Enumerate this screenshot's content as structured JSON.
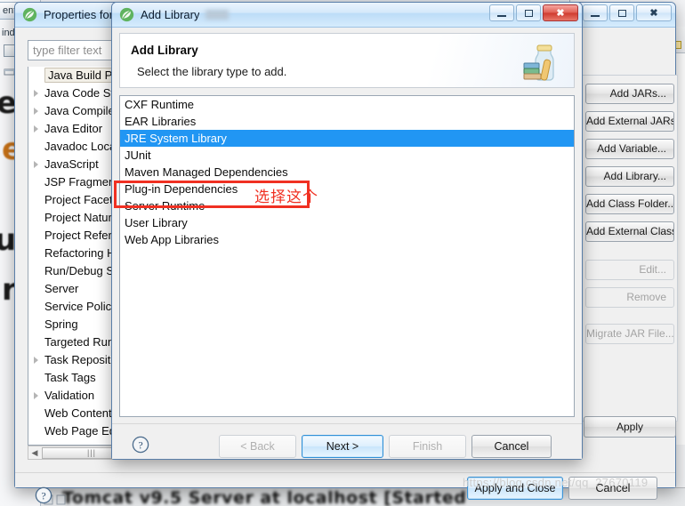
{
  "background": {
    "left_tab_label": "ent",
    "left_tab_label2": "ind",
    "big_letters": [
      "e",
      "e",
      "u",
      "r"
    ],
    "console_text": "Tomcat v9.5 Server at localhost  [Started",
    "nav_back_icon": "arrow-left-icon",
    "nav_forward_icon": "arrow-right-icon"
  },
  "watermark": "https://blog.csdn.net/qq_27670119",
  "properties_dialog": {
    "title": "Properties for",
    "app_icon": "eclipse-leaf-icon",
    "window_controls": {
      "minimize": "minimize-icon",
      "maximize": "maximize-icon",
      "close": "close-icon"
    },
    "filter": {
      "placeholder": "type filter text",
      "value": ""
    },
    "tree_items": [
      {
        "label": "Java Build Path",
        "expandable": false,
        "selected": true
      },
      {
        "label": "Java Code Style",
        "expandable": true,
        "selected": false
      },
      {
        "label": "Java Compiler",
        "expandable": true,
        "selected": false
      },
      {
        "label": "Java Editor",
        "expandable": true,
        "selected": false
      },
      {
        "label": "Javadoc Location",
        "expandable": false,
        "selected": false
      },
      {
        "label": "JavaScript",
        "expandable": true,
        "selected": false
      },
      {
        "label": "JSP Fragment",
        "expandable": false,
        "selected": false
      },
      {
        "label": "Project Facets",
        "expandable": false,
        "selected": false
      },
      {
        "label": "Project Natures",
        "expandable": false,
        "selected": false
      },
      {
        "label": "Project References",
        "expandable": false,
        "selected": false
      },
      {
        "label": "Refactoring History",
        "expandable": false,
        "selected": false
      },
      {
        "label": "Run/Debug Settings",
        "expandable": false,
        "selected": false
      },
      {
        "label": "Server",
        "expandable": false,
        "selected": false
      },
      {
        "label": "Service Policies",
        "expandable": false,
        "selected": false
      },
      {
        "label": "Spring",
        "expandable": false,
        "selected": false
      },
      {
        "label": "Targeted Runtimes",
        "expandable": false,
        "selected": false
      },
      {
        "label": "Task Repository",
        "expandable": true,
        "selected": false
      },
      {
        "label": "Task Tags",
        "expandable": false,
        "selected": false
      },
      {
        "label": "Validation",
        "expandable": true,
        "selected": false
      },
      {
        "label": "Web Content Settings",
        "expandable": false,
        "selected": false
      },
      {
        "label": "Web Page Editor",
        "expandable": false,
        "selected": false
      }
    ],
    "build_path_buttons": [
      {
        "label": "Add JARs...",
        "enabled": true
      },
      {
        "label": "Add External JARs...",
        "enabled": true
      },
      {
        "label": "Add Variable...",
        "enabled": true
      },
      {
        "label": "Add Library...",
        "enabled": true
      },
      {
        "label": "Add Class Folder...",
        "enabled": true
      },
      {
        "label": "Add External Class Folder...",
        "enabled": true
      },
      {
        "label": "Edit...",
        "enabled": false
      },
      {
        "label": "Remove",
        "enabled": false
      },
      {
        "label": "Migrate JAR File...",
        "enabled": false
      }
    ],
    "apply_label": "Apply",
    "apply_and_close_label": "Apply and Close",
    "cancel_label": "Cancel",
    "help_icon": "help-question-icon"
  },
  "add_library_dialog": {
    "title": "Add Library",
    "app_icon": "eclipse-leaf-icon",
    "window_controls": {
      "minimize": "minimize-icon",
      "maximize": "maximize-icon",
      "close": "close-icon"
    },
    "header": {
      "heading": "Add Library",
      "description": "Select the library type to add.",
      "icon": "library-jar-books-icon"
    },
    "library_types": [
      {
        "label": "CXF Runtime",
        "selected": false
      },
      {
        "label": "EAR Libraries",
        "selected": false
      },
      {
        "label": "JRE System Library",
        "selected": true
      },
      {
        "label": "JUnit",
        "selected": false
      },
      {
        "label": "Maven Managed Dependencies",
        "selected": false
      },
      {
        "label": "Plug-in Dependencies",
        "selected": false
      },
      {
        "label": "Server Runtime",
        "selected": false
      },
      {
        "label": "User Library",
        "selected": false
      },
      {
        "label": "Web App Libraries",
        "selected": false
      }
    ],
    "buttons": {
      "back": {
        "label": "< Back",
        "enabled": false
      },
      "next": {
        "label": "Next >",
        "enabled": true,
        "default": true
      },
      "finish": {
        "label": "Finish",
        "enabled": false
      },
      "cancel": {
        "label": "Cancel",
        "enabled": true
      }
    },
    "help_icon": "help-question-icon"
  },
  "annotation": {
    "note_text": "选择这个",
    "target_item": "Server Runtime",
    "color": "#f03022"
  }
}
